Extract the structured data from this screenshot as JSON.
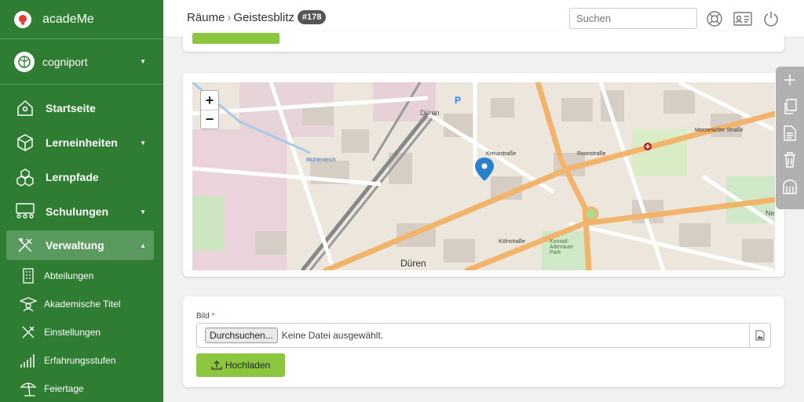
{
  "brand": {
    "name": "acadeMe"
  },
  "org": {
    "name": "cogniport"
  },
  "nav": {
    "items": [
      {
        "label": "Startseite"
      },
      {
        "label": "Lerneinheiten"
      },
      {
        "label": "Lernpfade"
      },
      {
        "label": "Schulungen"
      },
      {
        "label": "Verwaltung"
      }
    ],
    "sub_items": [
      {
        "label": "Abteilungen"
      },
      {
        "label": "Akademische Titel"
      },
      {
        "label": "Einstellungen"
      },
      {
        "label": "Erfahrungsstufen"
      },
      {
        "label": "Feiertage"
      }
    ]
  },
  "breadcrumb": {
    "parent": "Räume",
    "current": "Geistesblitz",
    "badge": "#178"
  },
  "search": {
    "placeholder": "Suchen"
  },
  "map": {
    "zoom_in": "+",
    "zoom_out": "−",
    "labels": {
      "duren_station": "Düren",
      "parking": "P",
      "duren_center": "Düren",
      "konrad_park": "Konrad-\nAdenauer\nPark",
      "kreuzstrasse": "Kreuzstraße",
      "kolnstrasse": "Kölnstraße",
      "roonstrasse": "Roonstraße",
      "merzenicher": "Merzenicher Straße",
      "muhlenteich": "Mühlenteich",
      "ne": "Ne"
    }
  },
  "upload": {
    "label": "Bild",
    "required_mark": "*",
    "browse": "Durchsuchen...",
    "no_file": "Keine Datei ausgewählt.",
    "button": "Hochladen"
  },
  "colors": {
    "sidebar": "#2e7d32",
    "accent": "#8cc63f"
  }
}
